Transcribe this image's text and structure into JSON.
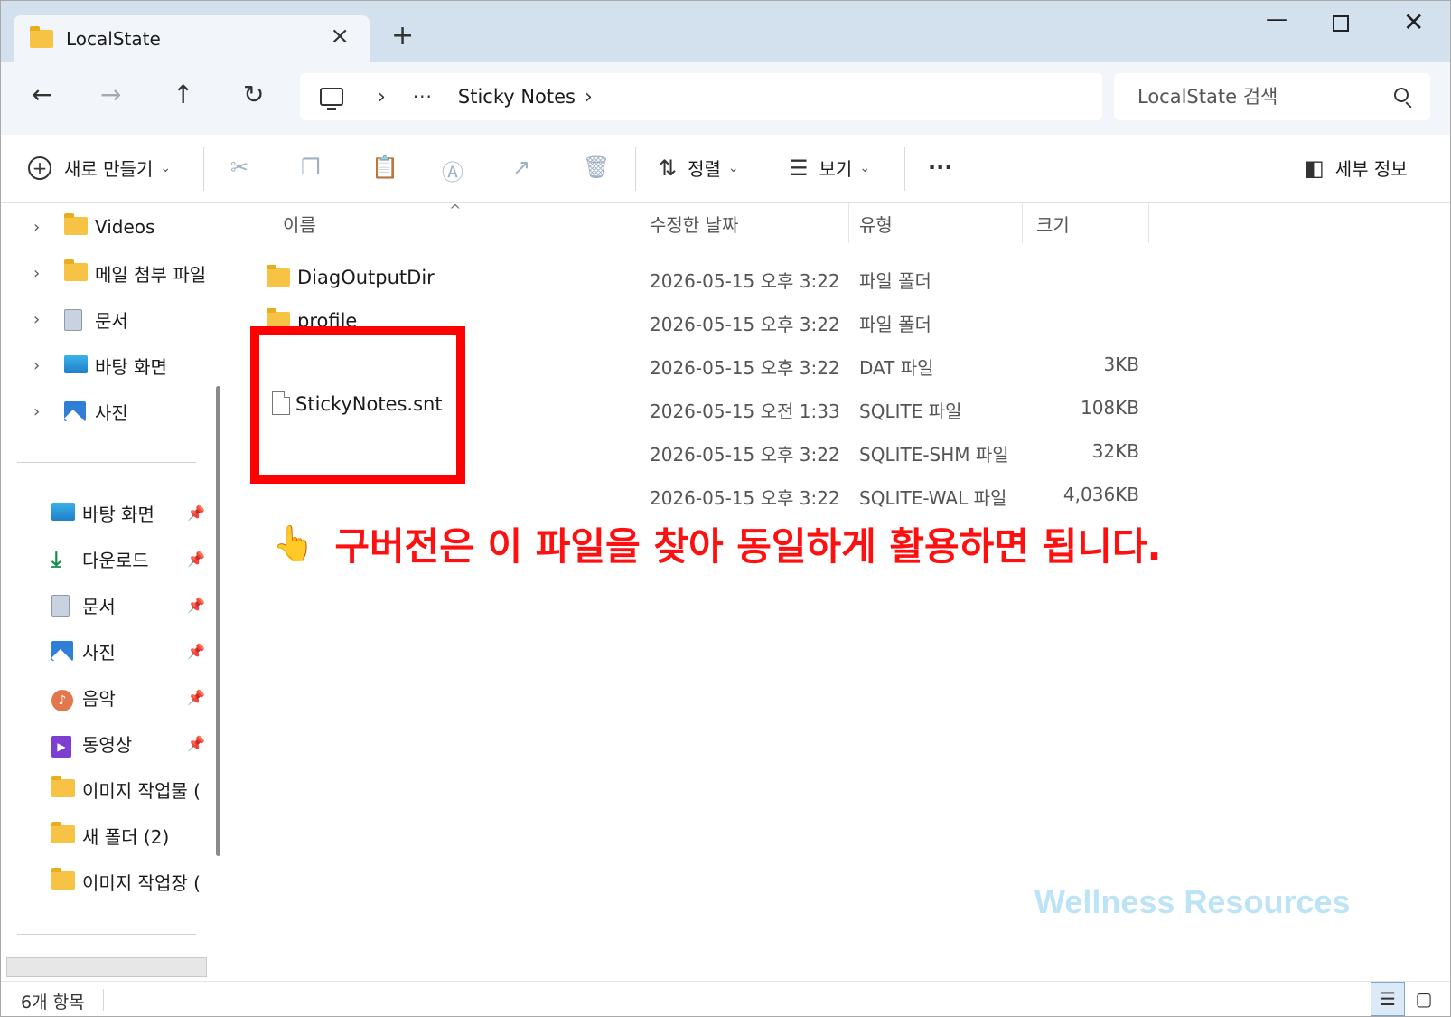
{
  "window": {
    "tab_title": "LocalState",
    "tab_close": "×",
    "new_tab": "+",
    "minimize": "—",
    "close": "✕"
  },
  "nav": {
    "back": "←",
    "forward": "→",
    "up": "↑",
    "refresh": "↻",
    "breadcrumb_sep": "›",
    "breadcrumb_more": "···",
    "breadcrumb": "Sticky Notes",
    "search_placeholder": "LocalState 검색"
  },
  "toolbar": {
    "new_label": "새로 만들기",
    "sort_label": "정렬",
    "view_label": "보기",
    "more_label": "···",
    "details_label": "세부 정보",
    "chevron": "⌄"
  },
  "sidebar": {
    "tree_items": [
      {
        "label": "Videos",
        "icon": "folder-icon"
      },
      {
        "label": "메일 첨부 파일",
        "icon": "folder-icon"
      },
      {
        "label": "문서",
        "icon": "documents-icon"
      },
      {
        "label": "바탕 화면",
        "icon": "desktop-icon"
      },
      {
        "label": "사진",
        "icon": "pictures-icon"
      }
    ],
    "quick_items": [
      {
        "label": "바탕 화면",
        "icon": "desktop-icon",
        "pinned": true
      },
      {
        "label": "다운로드",
        "icon": "download-icon",
        "pinned": true
      },
      {
        "label": "문서",
        "icon": "documents-icon",
        "pinned": true
      },
      {
        "label": "사진",
        "icon": "pictures-icon",
        "pinned": true
      },
      {
        "label": "음악",
        "icon": "music-icon",
        "pinned": true
      },
      {
        "label": "동영상",
        "icon": "videos-icon",
        "pinned": true
      },
      {
        "label": "이미지 작업물 (",
        "icon": "folder-icon",
        "pinned": false
      },
      {
        "label": "새 폴더 (2)",
        "icon": "folder-icon",
        "pinned": false
      },
      {
        "label": "이미지 작업장 (",
        "icon": "folder-icon",
        "pinned": false
      }
    ]
  },
  "columns": {
    "name": "이름",
    "date": "수정한 날짜",
    "type": "유형",
    "size": "크기"
  },
  "files": [
    {
      "name": "DiagOutputDir",
      "date": "2026-05-15 오후 3:22",
      "type": "파일 폴더",
      "size": ""
    },
    {
      "name": "profile",
      "date": "2026-05-15 오후 3:22",
      "type": "파일 폴더",
      "size": ""
    },
    {
      "name": "",
      "date": "2026-05-15 오후 3:22",
      "type": "DAT 파일",
      "size": "3KB"
    },
    {
      "name": "StickyNotes.snt",
      "date": "2026-05-15 오전 1:33",
      "type": "SQLITE 파일",
      "size": "108KB"
    },
    {
      "name": "",
      "date": "2026-05-15 오후 3:22",
      "type": "SQLITE-SHM 파일",
      "size": "32KB"
    },
    {
      "name": "",
      "date": "2026-05-15 오후 3:22",
      "type": "SQLITE-WAL 파일",
      "size": "4,036KB"
    }
  ],
  "annotation": {
    "hand": "👆",
    "text": "구버전은 이 파일을 찾아 동일하게 활용하면 됩니다."
  },
  "watermark": "Wellness Resources",
  "status": {
    "item_count": "6개 항목"
  },
  "colors": {
    "highlight": "#ff0000",
    "annotation": "#ff1010",
    "watermark": "#bde3f7",
    "titlebar": "#d3e0ee"
  }
}
